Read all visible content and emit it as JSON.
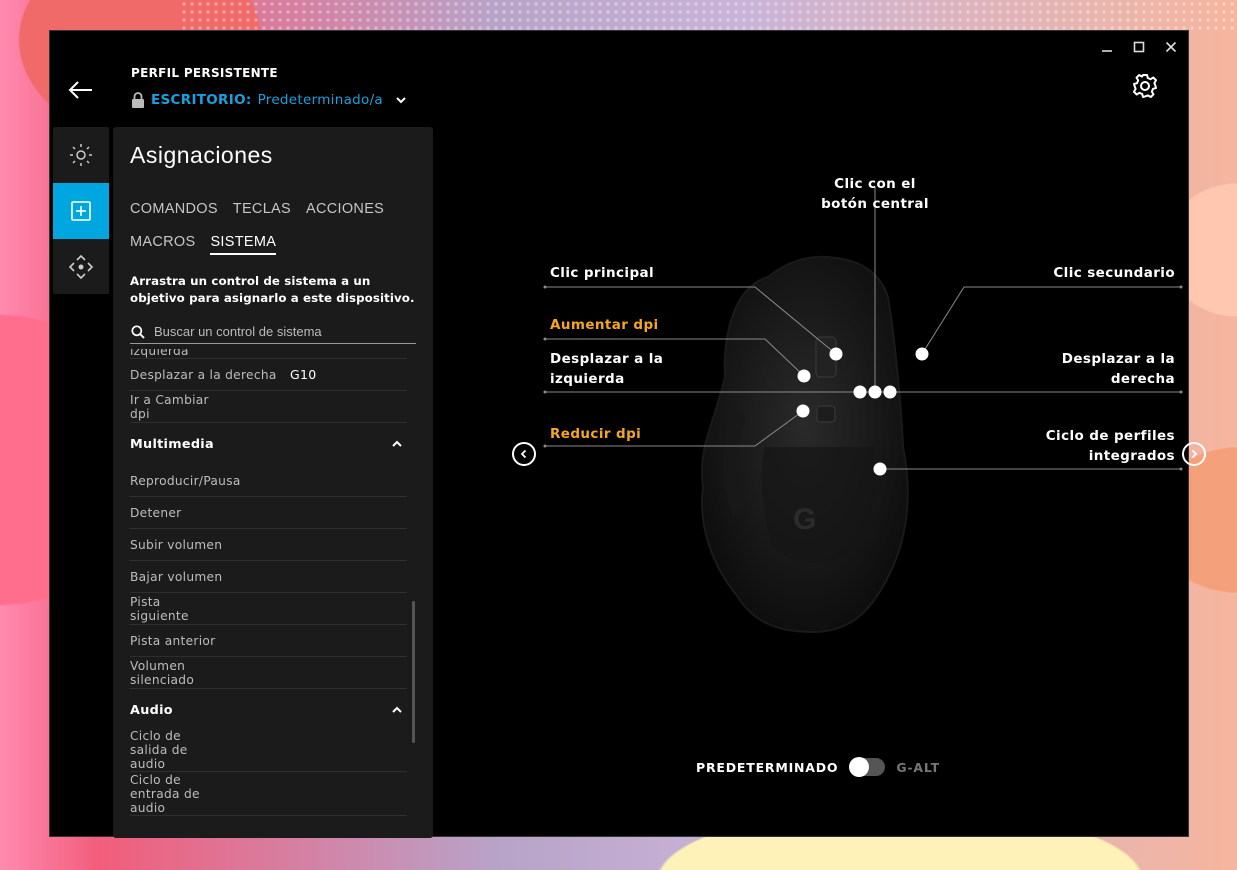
{
  "window": {
    "controls": [
      "minimize",
      "maximize",
      "close"
    ]
  },
  "header": {
    "profile_label": "PERFIL PERSISTENTE",
    "profile_kind": "ESCRITORIO:",
    "profile_name": "Predeterminado/a"
  },
  "rail": {
    "items": [
      {
        "icon": "lighting-icon",
        "active": false
      },
      {
        "icon": "assignments-plus-icon",
        "active": true
      },
      {
        "icon": "dpi-move-icon",
        "active": false
      }
    ]
  },
  "panel": {
    "title": "Asignaciones",
    "tabs_row1": [
      "COMANDOS",
      "TECLAS",
      "ACCIONES"
    ],
    "tabs_row2": [
      "MACROS",
      "SISTEMA"
    ],
    "active_tab": "SISTEMA",
    "instructions": "Arrastra un control de sistema a un objetivo para asignarlo a este dispositivo.",
    "search_placeholder": "Buscar un control de sistema",
    "list_top": [
      {
        "label": "izquierda",
        "value": ""
      },
      {
        "label": "Desplazar a la derecha",
        "value": "G10"
      },
      {
        "label": "Ir a Cambiar dpi",
        "value": ""
      }
    ],
    "multimedia": {
      "title": "Multimedia",
      "items": [
        "Reproducir/Pausa",
        "Detener",
        "Subir volumen",
        "Bajar volumen",
        "Pista siguiente",
        "Pista anterior",
        "Volumen silenciado"
      ]
    },
    "audio": {
      "title": "Audio",
      "items": [
        "Ciclo de salida de audio",
        "Ciclo de entrada de audio"
      ]
    }
  },
  "stage": {
    "labels": {
      "middle": "Clic con el botón central",
      "primary": "Clic principal",
      "secondary": "Clic secundario",
      "dpi_up": "Aumentar dpi",
      "scroll_left": "Desplazar a la izquierda",
      "scroll_right": "Desplazar a la derecha",
      "dpi_down": "Reducir dpi",
      "profile_cycle": "Ciclo de perfiles integrados"
    },
    "colors": {
      "highlight": "#f5a623",
      "accent": "#00a6e0"
    },
    "toggle": {
      "left": "PREDETERMINADO",
      "right": "G-ALT",
      "state": "PREDETERMINADO"
    }
  }
}
